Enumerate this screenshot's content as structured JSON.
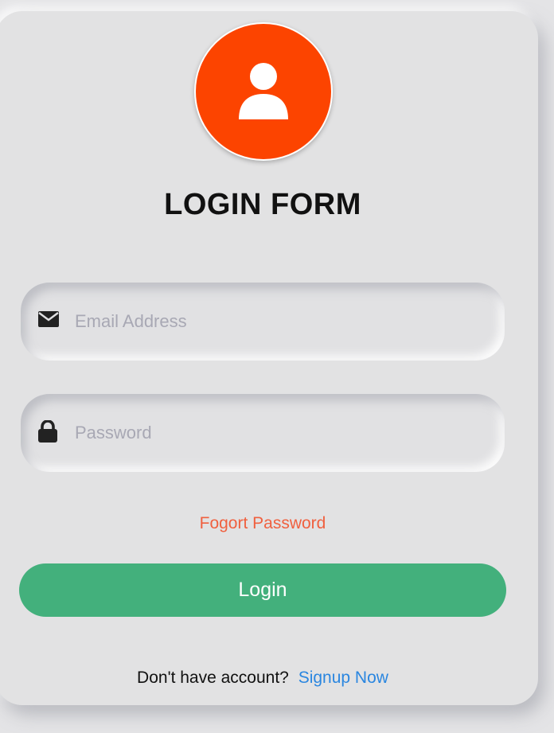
{
  "header": {
    "title": "LOGIN FORM"
  },
  "avatar": {
    "icon": "user-icon",
    "color": "#fc4400"
  },
  "form": {
    "email": {
      "icon": "envelope-icon",
      "placeholder": "Email Address",
      "value": ""
    },
    "password": {
      "icon": "lock-icon",
      "placeholder": "Password",
      "value": ""
    },
    "forgot_label": "Fogort Password",
    "login_label": "Login",
    "login_color": "#43b07c"
  },
  "footer": {
    "prompt": "Don't have account?",
    "signup_label": "Signup Now"
  }
}
